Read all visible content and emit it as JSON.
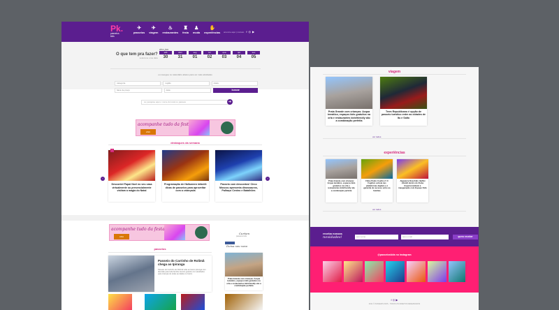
{
  "brand": {
    "logo": "Pk",
    "logo_dot": ".",
    "logo_sub": "passeios kids"
  },
  "nav": [
    {
      "label": "passeios",
      "icon": "plane-icon"
    },
    {
      "label": "viagem",
      "icon": "airplane-icon"
    },
    {
      "label": "restaurantes",
      "icon": "cutlery-icon"
    },
    {
      "label": "festa",
      "icon": "gift-icon"
    },
    {
      "label": "moda",
      "icon": "shirt-icon"
    },
    {
      "label": "experiências",
      "icon": "hand-icon"
    }
  ],
  "header_right": {
    "text": "anuncie aqui | contato",
    "social": [
      "f",
      "◎",
      "▶"
    ]
  },
  "hero": {
    "question": "O que tem pra fazer?",
    "question_sub": "selecione uma data",
    "month": "dez-jan",
    "days": [
      {
        "name": "sáb",
        "num": "30"
      },
      {
        "name": "dom",
        "num": "31"
      },
      {
        "name": "seg",
        "num": "01"
      },
      {
        "name": "ter",
        "num": "02"
      },
      {
        "name": "qua",
        "num": "03"
      },
      {
        "name": "qui",
        "num": "04"
      },
      {
        "name": "sex",
        "num": "05"
      }
    ],
    "tip": "ou navegue no calendário abaixo para ver mais atividades"
  },
  "filters": {
    "row1": [
      "categoria",
      "região",
      "idade"
    ],
    "row2": [
      "faixa de preço",
      "data"
    ],
    "search_button": "buscar",
    "search_placeholder": "ou pesquise aqui o nome do local ou passeio",
    "search_go": "➔"
  },
  "banner": {
    "text": "acompanhe tudo da festa",
    "badge": "ANU"
  },
  "destaques": {
    "title": "destaques da semana",
    "cards": [
      {
        "title": "Descontel Papai Noel no seu casa virtualmente ou presencialmente visitam a magia do Natal",
        "tag": "!"
      },
      {
        "title": "Programação de Halloween infantil: dicas de passeios para aproveitar com a criançada",
        "tag": "!"
      },
      {
        "title": "Passeio com descontos! Circo Moscou apresenta dinossauros, Palhaço Cenino e Batalhões",
        "tag": "!"
      }
    ],
    "prev": "‹",
    "next": "›"
  },
  "facebook": {
    "title": "Curtam",
    "caption": "passeios kids"
  },
  "passeios": {
    "title": "passeios",
    "featured_title": "Passeio do Carrinho de Rolimã chega ao Ipiranga",
    "featured_excerpt": "Passeio do Carrinho de Rolimã volta ao bairro Ipiranga com diversão para toda família. Evento gratuito com atividades para crianças de todas as idades no bairro."
  },
  "side": {
    "label": "Deixa seu vaso",
    "card_title": "Praia Grande com crianças: Acqua temático, espaços kids gratuitos na orla e restaurantes kidsfriendly são a combinação perfeita"
  },
  "page2": {
    "viagem": {
      "title": "viagem",
      "cards": [
        {
          "title": "Praia Grande com crianças: Acqua temático, espaços kids gratuitos na orla e restaurantes kidsfriendly são a combinação perfeita"
        },
        {
          "title": "Trem Republicano é opção de passeio turístico entre as cidades de Itu e Salto"
        }
      ],
      "ver": "ver todos"
    },
    "experiencias": {
      "title": "experiências",
      "cards": [
        {
          "title": "Praia Grande com crianças: Acqua temático, espaços kids gratuitos na orla e restaurantes kidsfriendly são a combinação perfeita"
        },
        {
          "title": "Filme Pedro Coelho 2: O Fugitivo estreia nas plataformas digitais e é garantia de sucesso entre as famílias"
        },
        {
          "title": "Algazarra Dow Kids: Buffet infantil dentro do Clube Esperia também é inauguração com Espaço Kids"
        }
      ],
      "ver": "ver todos"
    },
    "newsletter": {
      "label": "receba nossas",
      "label_em": "novidades!",
      "name_ph": "seu nome",
      "email_ph": "seu e-mail",
      "button": "quero receber"
    },
    "instagram": {
      "title": "@passeioskids no instagram"
    },
    "footer": {
      "social": "f  ◎  ▶",
      "copy": "2021 © PASSEIOS KIDS - TODOS OS DIREITOS RESERVADOS"
    }
  },
  "colors": {
    "purple": "#5b1e8f",
    "pink": "#d6287b",
    "insta_pink": "#ff1f73",
    "bg": "#5d6166"
  }
}
